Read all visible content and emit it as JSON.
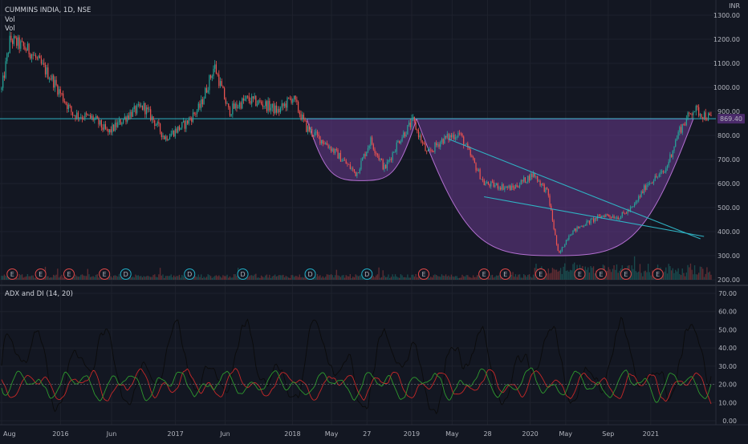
{
  "symbol_header": "CUMMINS INDIA, 1D, NSE",
  "vol_labels": [
    "Vol",
    "Vol"
  ],
  "price_currency": "INR",
  "last_price_label": "869.40",
  "adx_header": "ADX and DI (14, 20)",
  "colors": {
    "background": "#131722",
    "grid": "#1e222d",
    "up": "#26a69a",
    "down": "#ef5350",
    "cup_fill": "#6a3a8e",
    "cup_stroke": "#b26fd0",
    "trendline": "#2fb3c4",
    "neckline": "#2fb3c4",
    "adx": "#000000",
    "plus_di": "#2e9a2e",
    "minus_di": "#c62828",
    "event_earnings": "#e04848",
    "event_dividend": "#21b0c8"
  },
  "chart_data": [
    {
      "type": "candlestick",
      "title": "CUMMINS INDIA, 1D, NSE",
      "y_axis_ticks": [
        "1300.00",
        "1200.00",
        "1100.00",
        "1000.00",
        "900.00",
        "800.00",
        "700.00",
        "600.00",
        "500.00",
        "400.00",
        "300.00",
        "200.00"
      ],
      "ylim": [
        200,
        1300
      ],
      "x_axis_ticks": [
        "Aug",
        "2016",
        "Jun",
        "2017",
        "Jun",
        "2018",
        "May",
        "27",
        "2019",
        "May",
        "28",
        "2020",
        "May",
        "Sep",
        "2021"
      ],
      "anchor_closes": [
        {
          "t": 0.0,
          "v": 990
        },
        {
          "t": 0.012,
          "v": 1200
        },
        {
          "t": 0.04,
          "v": 1150
        },
        {
          "t": 0.07,
          "v": 1040
        },
        {
          "t": 0.1,
          "v": 890
        },
        {
          "t": 0.13,
          "v": 870
        },
        {
          "t": 0.15,
          "v": 810
        },
        {
          "t": 0.18,
          "v": 890
        },
        {
          "t": 0.2,
          "v": 920
        },
        {
          "t": 0.215,
          "v": 860
        },
        {
          "t": 0.23,
          "v": 790
        },
        {
          "t": 0.26,
          "v": 850
        },
        {
          "t": 0.28,
          "v": 920
        },
        {
          "t": 0.3,
          "v": 1090
        },
        {
          "t": 0.32,
          "v": 900
        },
        {
          "t": 0.345,
          "v": 950
        },
        {
          "t": 0.37,
          "v": 930
        },
        {
          "t": 0.39,
          "v": 900
        },
        {
          "t": 0.41,
          "v": 960
        },
        {
          "t": 0.43,
          "v": 830
        },
        {
          "t": 0.46,
          "v": 760
        },
        {
          "t": 0.48,
          "v": 700
        },
        {
          "t": 0.5,
          "v": 640
        },
        {
          "t": 0.52,
          "v": 780
        },
        {
          "t": 0.54,
          "v": 660
        },
        {
          "t": 0.56,
          "v": 780
        },
        {
          "t": 0.58,
          "v": 860
        },
        {
          "t": 0.6,
          "v": 720
        },
        {
          "t": 0.62,
          "v": 780
        },
        {
          "t": 0.645,
          "v": 810
        },
        {
          "t": 0.68,
          "v": 600
        },
        {
          "t": 0.72,
          "v": 580
        },
        {
          "t": 0.75,
          "v": 640
        },
        {
          "t": 0.77,
          "v": 560
        },
        {
          "t": 0.785,
          "v": 300
        },
        {
          "t": 0.8,
          "v": 390
        },
        {
          "t": 0.82,
          "v": 430
        },
        {
          "t": 0.85,
          "v": 470
        },
        {
          "t": 0.87,
          "v": 460
        },
        {
          "t": 0.89,
          "v": 500
        },
        {
          "t": 0.91,
          "v": 600
        },
        {
          "t": 0.935,
          "v": 650
        },
        {
          "t": 0.955,
          "v": 820
        },
        {
          "t": 0.975,
          "v": 910
        },
        {
          "t": 1.0,
          "v": 869.4
        }
      ],
      "events": [
        {
          "kind": "E",
          "t": 0.015
        },
        {
          "kind": "E",
          "t": 0.055
        },
        {
          "kind": "E",
          "t": 0.095
        },
        {
          "kind": "E",
          "t": 0.145
        },
        {
          "kind": "D",
          "t": 0.175
        },
        {
          "kind": "D",
          "t": 0.265
        },
        {
          "kind": "D",
          "t": 0.34
        },
        {
          "kind": "D",
          "t": 0.435
        },
        {
          "kind": "D",
          "t": 0.515
        },
        {
          "kind": "E",
          "t": 0.595
        },
        {
          "kind": "E",
          "t": 0.68
        },
        {
          "kind": "E",
          "t": 0.71
        },
        {
          "kind": "E",
          "t": 0.76
        },
        {
          "kind": "E",
          "t": 0.815
        },
        {
          "kind": "E",
          "t": 0.845
        },
        {
          "kind": "E",
          "t": 0.88
        },
        {
          "kind": "E",
          "t": 0.925
        }
      ],
      "cup_and_handle": {
        "rim_price": 869.4,
        "small_cup": {
          "t_start": 0.43,
          "t_end": 0.585,
          "bottom_price": 612
        },
        "large_cup": {
          "t_start": 0.585,
          "t_end": 0.975,
          "bottom_price": 300
        }
      },
      "wedge_lines": [
        {
          "t1": 0.63,
          "p1": 785,
          "t2": 0.985,
          "p2": 370
        },
        {
          "t1": 0.68,
          "p1": 545,
          "t2": 0.99,
          "p2": 380
        }
      ]
    },
    {
      "type": "line",
      "title": "ADX and DI (14, 20)",
      "y_axis_ticks": [
        "70.00",
        "60.00",
        "50.00",
        "40.00",
        "30.00",
        "20.00",
        "10.00",
        "0.00"
      ],
      "ylim": [
        0,
        70
      ],
      "series": []
    }
  ]
}
